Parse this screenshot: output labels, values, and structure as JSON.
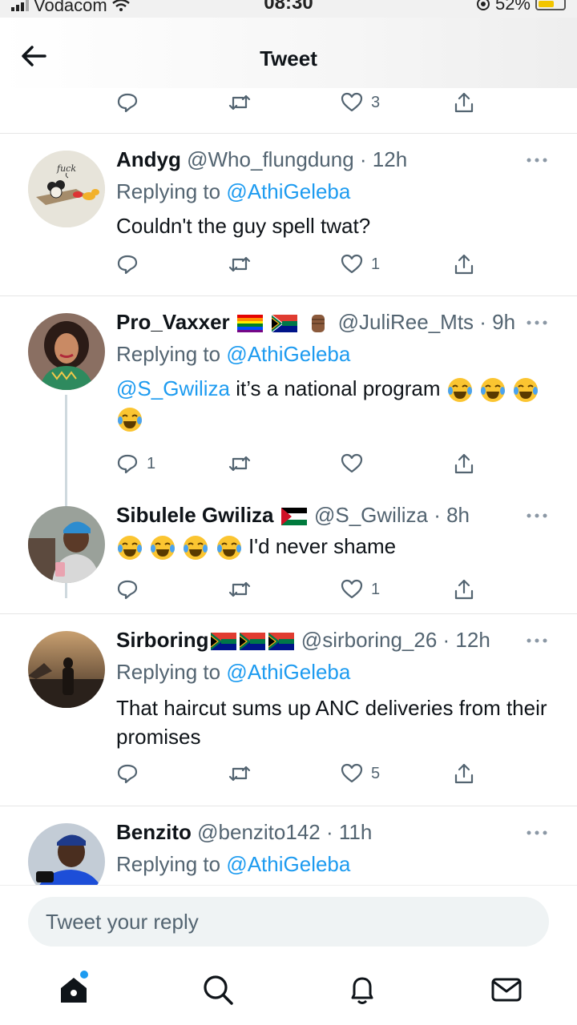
{
  "status_bar": {
    "carrier": "Vodacom",
    "time": "08:30",
    "battery": "52%"
  },
  "header": {
    "title": "Tweet"
  },
  "top_actions": {
    "likes": "3"
  },
  "tweets": [
    {
      "name": "Andyg",
      "handle": "@Who_flungdung",
      "time": "· 12h",
      "replying_prefix": "Replying to ",
      "replying_to": "@AthiGeleba",
      "text": "Couldn't the guy spell twat?",
      "likes": "1",
      "replies": "",
      "avatar_text": "fuck"
    },
    {
      "name": "Pro_Vaxxer",
      "handle": "@JuliRee_Mts",
      "time": "· 9h",
      "replying_prefix": "Replying to ",
      "replying_to": "@AthiGeleba",
      "mention": "@S_Gwiliza",
      "text": " it’s a national program",
      "likes": "",
      "replies": "1"
    },
    {
      "name": "Sibulele Gwiliza",
      "handle": "@S_Gwiliza",
      "time": "· 8h",
      "text": "I'd  never shame",
      "likes": "1",
      "replies": ""
    },
    {
      "name": "Sirboring",
      "handle": "@sirboring_26",
      "time": "· 12h",
      "replying_prefix": "Replying to ",
      "replying_to": "@AthiGeleba",
      "text": "That haircut sums up ANC deliveries from their promises",
      "likes": "5",
      "replies": ""
    },
    {
      "name": "Benzito",
      "handle": "@benzito142",
      "time": "· 11h",
      "replying_prefix": "Replying to ",
      "replying_to": "@AthiGeleba"
    }
  ],
  "reply_box": {
    "placeholder": "Tweet your reply"
  },
  "nav": {
    "items": [
      "home-icon",
      "search-icon",
      "notifications-icon",
      "messages-icon"
    ]
  },
  "colors": {
    "link": "#1d9bf0",
    "muted": "#536471",
    "text": "#0f1419"
  }
}
